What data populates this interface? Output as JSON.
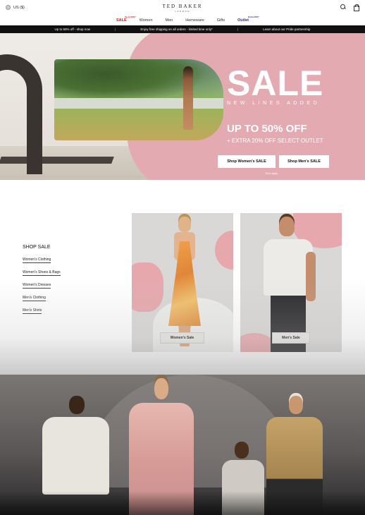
{
  "header": {
    "locale": "US ($)",
    "logo_main": "TED BAKER",
    "logo_sub": "LONDON"
  },
  "nav": {
    "items": [
      {
        "label": "SALE",
        "badge": "Up to 50%*"
      },
      {
        "label": "Women"
      },
      {
        "label": "Men"
      },
      {
        "label": "Homeware"
      },
      {
        "label": "Gifts"
      },
      {
        "label": "Outlet",
        "badge": "Extra 20%*"
      }
    ]
  },
  "promo": {
    "messages": [
      "Up to 50% off - shop now",
      "Enjoy free shipping on all orders - limited time only*",
      "Learn about our Pride partnership"
    ],
    "separator": "|"
  },
  "hero": {
    "title": "SALE",
    "subtitle": "NEW LINES ADDED",
    "headline": "UP TO 50% OFF",
    "extra": "+ EXTRA 20% OFF SELECT OUTLET",
    "btn_women": "Shop Women's SALE",
    "btn_men": "Shop Men's SALE",
    "terms": "T&Cs apply",
    "pink": "#e4aab1"
  },
  "shop_sale": {
    "title": "SHOP SALE",
    "links": [
      "Women's Clothing",
      "Women's Shoes & Bags",
      "Women's Dresses",
      "Men's Clothing",
      "Men's Shirts"
    ]
  },
  "cards": {
    "women_label": "Women's Sale",
    "men_label": "Men's Sale"
  },
  "icons": {
    "search": "search-icon",
    "bag": "bag-icon",
    "flag": "flag-icon"
  }
}
